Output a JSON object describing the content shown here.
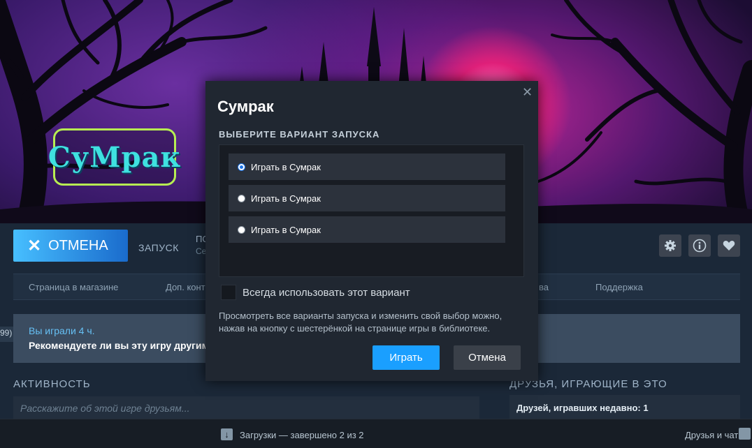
{
  "hero": {
    "logo_text": "СуМрак"
  },
  "action_bar": {
    "cancel_label": "ОТМЕНА",
    "launch_label": "ЗАПУСК",
    "truncated_top": "ПО",
    "truncated_bottom": "Се",
    "icons": [
      "gear-icon",
      "info-icon",
      "heart-icon"
    ]
  },
  "subnav": {
    "items": [
      "Страница в магазине",
      "Доп. конт",
      "ва",
      "Поддержка"
    ]
  },
  "review": {
    "side_badge": "99)",
    "played": "Вы играли 4 ч.",
    "ask": "Рекомендуете ли вы эту игру другим п"
  },
  "activity": {
    "title": "АКТИВНОСТЬ",
    "placeholder": "Расскажите об этой игре друзьям..."
  },
  "friends": {
    "title": "ДРУЗЬЯ, ИГРАЮЩИЕ В ЭТО",
    "recent": "Друзей, игравших недавно: 1"
  },
  "bottom_bar": {
    "downloads": "Загрузки — завершено 2 из 2",
    "friends_chat": "Друзья и чат"
  },
  "dialog": {
    "close_glyph": "✕",
    "title": "Сумрак",
    "subtitle": "ВЫБЕРИТЕ ВАРИАНТ ЗАПУСКА",
    "options": [
      {
        "label": "Играть в Сумрак",
        "selected": true
      },
      {
        "label": "Играть в Сумрак",
        "selected": false
      },
      {
        "label": "Играть в Сумрак",
        "selected": false
      }
    ],
    "always_use_label": "Всегда использовать этот вариант",
    "always_use_checked": false,
    "note": "Просмотреть все варианты запуска и изменить свой выбор можно, нажав на кнопку с шестерёнкой на странице игры в библиотеке.",
    "play_button": "Играть",
    "cancel_button": "Отмена"
  },
  "colors": {
    "accent": "#1a9fff",
    "cancel_gradient_start": "#47bfff",
    "cancel_gradient_end": "#1a6bcc",
    "background": "#1b2838",
    "dialog_bg": "#202731",
    "played_text": "#66c0f4"
  }
}
